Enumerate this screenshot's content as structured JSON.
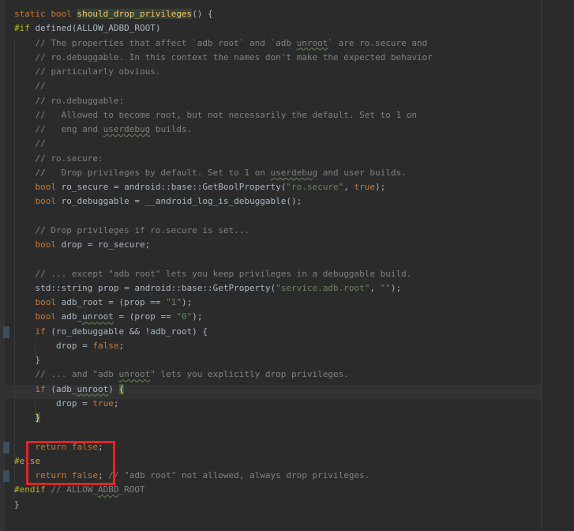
{
  "editor": {
    "lines": [
      [
        {
          "t": "static bool ",
          "c": "kw"
        },
        {
          "t": "should_drop_privileges",
          "c": "fn hl-fn"
        },
        {
          "t": "() {",
          "c": ""
        }
      ],
      [
        {
          "t": "#if ",
          "c": "pp"
        },
        {
          "t": "defined(ALLOW_ADBD_ROOT)",
          "c": ""
        }
      ],
      [
        {
          "t": "    // The properties that affect `adb root` and `adb ",
          "c": "cm"
        },
        {
          "t": "unroot",
          "c": "cm uline"
        },
        {
          "t": "` are ro.secure and",
          "c": "cm"
        }
      ],
      [
        {
          "t": "    // ro.debuggable. In this context the names don't make the expected behavior",
          "c": "cm"
        }
      ],
      [
        {
          "t": "    // particularly obvious.",
          "c": "cm"
        }
      ],
      [
        {
          "t": "    //",
          "c": "cm"
        }
      ],
      [
        {
          "t": "    // ro.debuggable:",
          "c": "cm"
        }
      ],
      [
        {
          "t": "    //   Allowed to become root, but not necessarily the default. Set to 1 on",
          "c": "cm"
        }
      ],
      [
        {
          "t": "    //   eng and ",
          "c": "cm"
        },
        {
          "t": "userdebug",
          "c": "cm uline"
        },
        {
          "t": " builds.",
          "c": "cm"
        }
      ],
      [
        {
          "t": "    //",
          "c": "cm"
        }
      ],
      [
        {
          "t": "    // ro.secure:",
          "c": "cm"
        }
      ],
      [
        {
          "t": "    //   Drop privileges by default. Set to 1 on ",
          "c": "cm"
        },
        {
          "t": "userdebug",
          "c": "cm uline"
        },
        {
          "t": " and user builds.",
          "c": "cm"
        }
      ],
      [
        {
          "t": "    ",
          "c": ""
        },
        {
          "t": "bool ",
          "c": "kw"
        },
        {
          "t": "ro_secure = android::base::GetBoolProperty(",
          "c": ""
        },
        {
          "t": "\"ro.secure\"",
          "c": "str"
        },
        {
          "t": ", ",
          "c": ""
        },
        {
          "t": "true",
          "c": "kw"
        },
        {
          "t": ");",
          "c": ""
        }
      ],
      [
        {
          "t": "    ",
          "c": ""
        },
        {
          "t": "bool ",
          "c": "kw"
        },
        {
          "t": "ro_debuggable = __android_log_is_debuggable();",
          "c": ""
        }
      ],
      [
        {
          "t": "",
          "c": ""
        }
      ],
      [
        {
          "t": "    // Drop privileges if ro.secure is set...",
          "c": "cm"
        }
      ],
      [
        {
          "t": "    ",
          "c": ""
        },
        {
          "t": "bool ",
          "c": "kw"
        },
        {
          "t": "drop = ro_secure;",
          "c": ""
        }
      ],
      [
        {
          "t": "",
          "c": ""
        }
      ],
      [
        {
          "t": "    // ... except \"adb root\" lets you keep privileges in a debuggable build.",
          "c": "cm"
        }
      ],
      [
        {
          "t": "    std::string prop = android::base::GetProperty(",
          "c": ""
        },
        {
          "t": "\"service.adb.root\"",
          "c": "str"
        },
        {
          "t": ", ",
          "c": ""
        },
        {
          "t": "\"\"",
          "c": "str"
        },
        {
          "t": ");",
          "c": ""
        }
      ],
      [
        {
          "t": "    ",
          "c": ""
        },
        {
          "t": "bool ",
          "c": "kw"
        },
        {
          "t": "adb_root = (prop == ",
          "c": ""
        },
        {
          "t": "\"1\"",
          "c": "str"
        },
        {
          "t": ");",
          "c": ""
        }
      ],
      [
        {
          "t": "    ",
          "c": ""
        },
        {
          "t": "bool ",
          "c": "kw"
        },
        {
          "t": "adb_",
          "c": ""
        },
        {
          "t": "unroot",
          "c": "uline"
        },
        {
          "t": " = (prop == ",
          "c": ""
        },
        {
          "t": "\"0\"",
          "c": "str"
        },
        {
          "t": ");",
          "c": ""
        }
      ],
      [
        {
          "t": "    ",
          "c": ""
        },
        {
          "t": "if ",
          "c": "kw"
        },
        {
          "t": "(ro_debuggable && !adb_root) {",
          "c": ""
        }
      ],
      [
        {
          "t": "        drop = ",
          "c": ""
        },
        {
          "t": "false",
          "c": "kw"
        },
        {
          "t": ";",
          "c": ""
        }
      ],
      [
        {
          "t": "    }",
          "c": ""
        }
      ],
      [
        {
          "t": "    // ... and \"adb ",
          "c": "cm"
        },
        {
          "t": "unroot",
          "c": "cm uline"
        },
        {
          "t": "\" lets you explicitly drop privileges.",
          "c": "cm"
        }
      ],
      [
        {
          "t": "    ",
          "c": ""
        },
        {
          "t": "if ",
          "c": "kw"
        },
        {
          "t": "(adb_",
          "c": ""
        },
        {
          "t": "unroot",
          "c": "uline"
        },
        {
          "t": ") ",
          "c": ""
        },
        {
          "t": "{",
          "c": "hl-brace"
        }
      ],
      [
        {
          "t": "        drop = ",
          "c": ""
        },
        {
          "t": "true",
          "c": "kw"
        },
        {
          "t": ";",
          "c": ""
        }
      ],
      [
        {
          "t": "    ",
          "c": ""
        },
        {
          "t": "}",
          "c": "hl-brace"
        }
      ],
      [
        {
          "t": "",
          "c": ""
        }
      ],
      [
        {
          "t": "    ",
          "c": ""
        },
        {
          "t": "return false",
          "c": "kw"
        },
        {
          "t": ";",
          "c": ""
        }
      ],
      [
        {
          "t": "#else",
          "c": "pp"
        }
      ],
      [
        {
          "t": "    ",
          "c": ""
        },
        {
          "t": "return false",
          "c": "kw"
        },
        {
          "t": "; ",
          "c": ""
        },
        {
          "t": "// \"adb root\" not allowed, always drop privileges.",
          "c": "cm"
        }
      ],
      [
        {
          "t": "#endif ",
          "c": "pp"
        },
        {
          "t": "// ALLOW_",
          "c": "cm"
        },
        {
          "t": "ADBD",
          "c": "cm uline"
        },
        {
          "t": "_ROOT",
          "c": "cm"
        }
      ],
      [
        {
          "t": "}",
          "c": ""
        }
      ]
    ]
  },
  "colors": {
    "background": "#2b2b2b",
    "keyword": "#cc7832",
    "function": "#ffc66d",
    "string": "#6a8759",
    "comment": "#808080",
    "preprocessor": "#bbb529",
    "annotation": "#e02525"
  }
}
